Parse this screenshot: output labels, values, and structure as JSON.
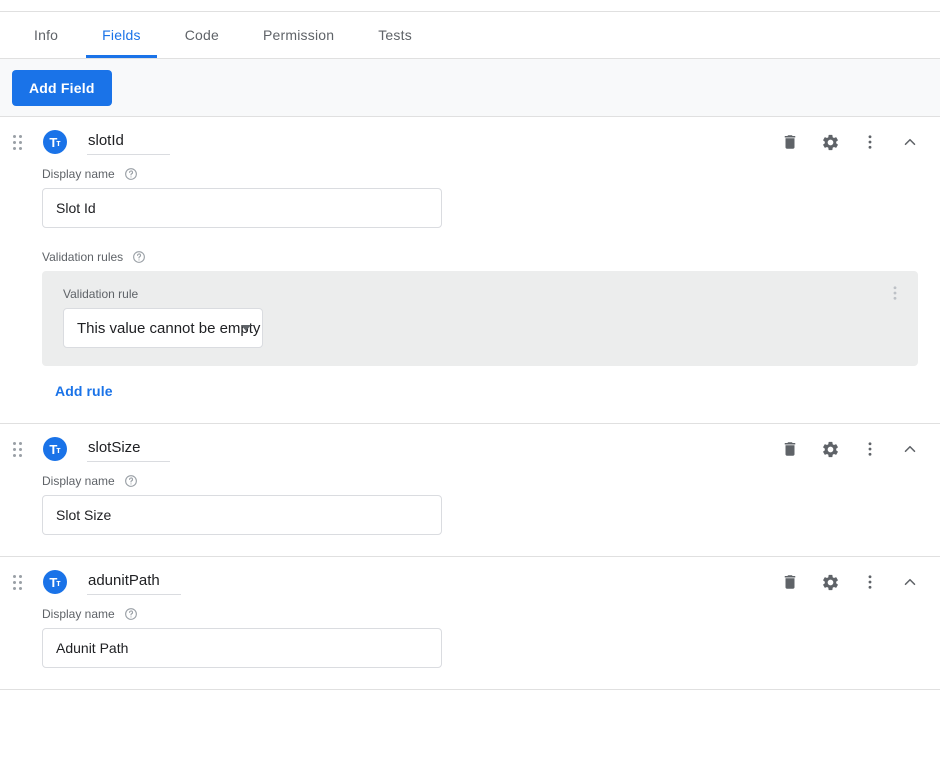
{
  "tabs": [
    {
      "label": "Info",
      "active": false
    },
    {
      "label": "Fields",
      "active": true
    },
    {
      "label": "Code",
      "active": false
    },
    {
      "label": "Permission",
      "active": false
    },
    {
      "label": "Tests",
      "active": false
    }
  ],
  "toolbar": {
    "add_field_label": "Add Field"
  },
  "labels": {
    "display_name": "Display name",
    "validation_rules": "Validation rules",
    "validation_rule": "Validation rule",
    "add_rule": "Add rule"
  },
  "colors": {
    "accent": "#1a73e8",
    "tab_inactive": "#5f6368",
    "panel_bg": "#eceded",
    "border": "#e0e0e0"
  },
  "icons": {
    "drag_handle": "drag-handle-icon",
    "type_text": "text-type-icon",
    "delete": "trash-icon",
    "settings": "gear-icon",
    "more": "more-vert-icon",
    "collapse": "chevron-up-icon",
    "help": "help-circle-icon",
    "dropdown": "chevron-down-icon"
  },
  "fields": [
    {
      "name": "slotId",
      "type_icon_big": "T",
      "type_icon_small": "т",
      "display_name_value": "Slot Id",
      "validation": {
        "rules": [
          {
            "value": "This value cannot be empty"
          }
        ]
      }
    },
    {
      "name": "slotSize",
      "type_icon_big": "T",
      "type_icon_small": "т",
      "display_name_value": "Slot Size",
      "validation": null
    },
    {
      "name": "adunitPath",
      "type_icon_big": "T",
      "type_icon_small": "т",
      "display_name_value": "Adunit Path",
      "validation": null
    }
  ]
}
